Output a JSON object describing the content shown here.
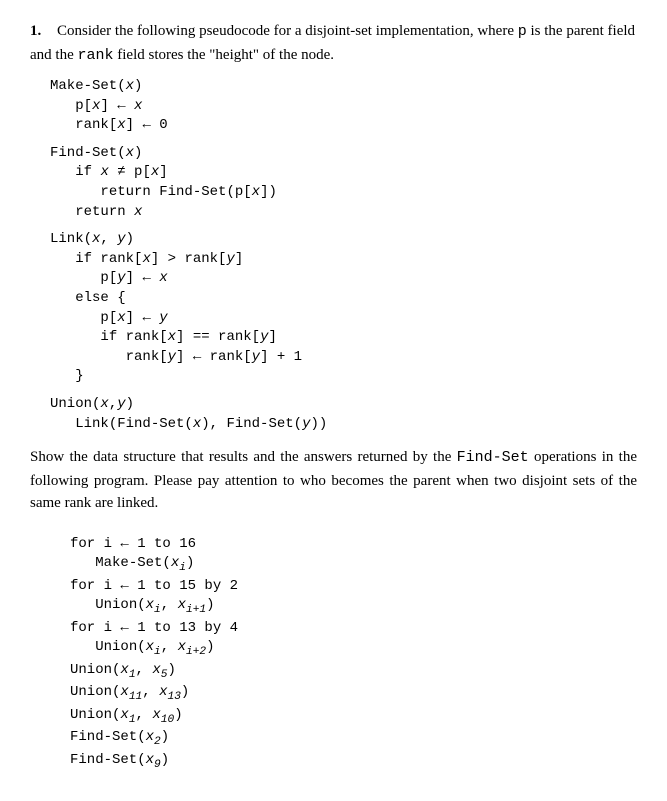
{
  "question": {
    "number": "1.",
    "intro_pre": "Consider the following pseudocode for a disjoint-set implementation, where ",
    "intro_p": "p",
    "intro_mid1": " is the parent field and the ",
    "intro_rank": "rank",
    "intro_post": " field stores the \"height\" of the node."
  },
  "makeset": {
    "header_name": "Make-Set",
    "header_paren_open": "(",
    "header_arg": "x",
    "header_paren_close": ")",
    "l1_px": "p[",
    "l1_x": "x",
    "l1_close": "] ← ",
    "l1_val": "x",
    "l2_rank": "rank[",
    "l2_x": "x",
    "l2_close": "] ← 0"
  },
  "findset": {
    "header_name": "Find-Set",
    "header_paren_open": "(",
    "header_arg": "x",
    "header_paren_close": ")",
    "l1_if": "if ",
    "l1_x": "x",
    "l1_neq": " ≠ p[",
    "l1_x2": "x",
    "l1_close": "]",
    "l2_ret": "return Find-Set(p[",
    "l2_x": "x",
    "l2_close": "])",
    "l3_ret": "return ",
    "l3_x": "x"
  },
  "link": {
    "header_name": "Link",
    "header_paren_open": "(",
    "header_arg1": "x",
    "header_comma": ", ",
    "header_arg2": "y",
    "header_paren_close": ")",
    "l1": "if rank[",
    "l1_x": "x",
    "l1_gt": "] > rank[",
    "l1_y": "y",
    "l1_close": "]",
    "l2_py": "p[",
    "l2_y": "y",
    "l2_assign": "] ← ",
    "l2_x": "x",
    "l3_else": "else {",
    "l4_px": "p[",
    "l4_x": "x",
    "l4_assign": "] ← ",
    "l4_y": "y",
    "l5_if": "if rank[",
    "l5_x": "x",
    "l5_eq": "] == rank[",
    "l5_y": "y",
    "l5_close": "]",
    "l6_rank": "rank[",
    "l6_y": "y",
    "l6_assign": "] ← rank[",
    "l6_y2": "y",
    "l6_plus": "] + 1",
    "l7_close": "}"
  },
  "union": {
    "header_name": "Union",
    "header_paren_open": "(",
    "header_arg1": "x",
    "header_comma": ",",
    "header_arg2": "y",
    "header_paren_close": ")",
    "l1_link": "Link(Find-Set(",
    "l1_x": "x",
    "l1_mid": "), Find-Set(",
    "l1_y": "y",
    "l1_close": "))"
  },
  "midtext": {
    "t1": "Show the data structure that results and the answers returned by the ",
    "t2": "Find-Set",
    "t3": " operations in the following program. Please pay attention to who becomes the parent when two disjoint sets of the same rank are linked."
  },
  "prog": {
    "l1": "for i ← 1 to 16",
    "l2_pre": "Make-Set(",
    "l2_x": "x",
    "l2_sub": "i",
    "l2_post": ")",
    "l3": "for i ← 1 to 15 by 2",
    "l4_pre": "Union(",
    "l4_x1": "x",
    "l4_sub1": "i",
    "l4_comma": ", ",
    "l4_x2": "x",
    "l4_sub2": "i+1",
    "l4_post": ")",
    "l5": "for i ← 1 to 13 by 4",
    "l6_pre": "Union(",
    "l6_x1": "x",
    "l6_sub1": "i",
    "l6_comma": ", ",
    "l6_x2": "x",
    "l6_sub2": "i+2",
    "l6_post": ")",
    "u1_pre": "Union(",
    "u1_x1": "x",
    "u1_sub1": "1",
    "u1_comma": ", ",
    "u1_x2": "x",
    "u1_sub2": "5",
    "u1_post": ")",
    "u2_pre": "Union(",
    "u2_x1": "x",
    "u2_sub1": "11",
    "u2_comma": ", ",
    "u2_x2": "x",
    "u2_sub2": "13",
    "u2_post": ")",
    "u3_pre": "Union(",
    "u3_x1": "x",
    "u3_sub1": "1",
    "u3_comma": ", ",
    "u3_x2": "x",
    "u3_sub2": "10",
    "u3_post": ")",
    "f1_pre": "Find-Set(",
    "f1_x": "x",
    "f1_sub": "2",
    "f1_post": ")",
    "f2_pre": "Find-Set(",
    "f2_x": "x",
    "f2_sub": "9",
    "f2_post": ")"
  }
}
